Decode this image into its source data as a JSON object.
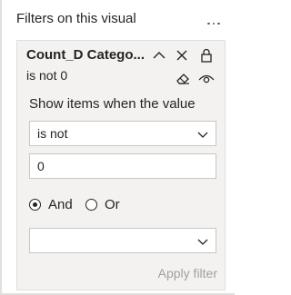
{
  "pane": {
    "section_title": "Filters on this visual"
  },
  "filter_card": {
    "title": "Count_D Catego...",
    "subtitle": "is not 0",
    "show_items_label": "Show items when the value",
    "condition1": {
      "operator": "is not",
      "value": "0"
    },
    "logic": {
      "and_label": "And",
      "or_label": "Or",
      "selected": "And"
    },
    "condition2": {
      "operator": "",
      "value": ""
    },
    "apply_label": "Apply filter"
  },
  "colors": {
    "card_bg": "#f3f2f1",
    "border": "#c8c6c4",
    "text": "#252423",
    "disabled_text": "#a19f9d"
  }
}
